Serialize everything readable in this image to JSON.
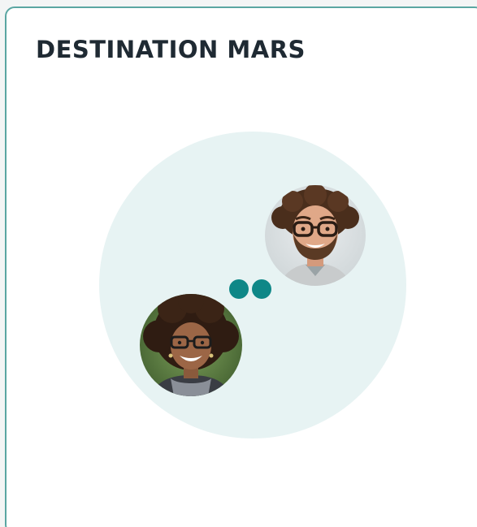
{
  "card": {
    "title": "DESTINATION MARS"
  },
  "colors": {
    "accent": "#0e8787",
    "circle_bg": "#e7f3f3",
    "card_border": "#5aa6a2",
    "title_text": "#1f2a33"
  },
  "avatars": [
    {
      "icon": "man-avatar-icon"
    },
    {
      "icon": "woman-avatar-icon"
    }
  ],
  "indicator": {
    "icon": "typing-dots-icon",
    "dot_count": 2
  }
}
